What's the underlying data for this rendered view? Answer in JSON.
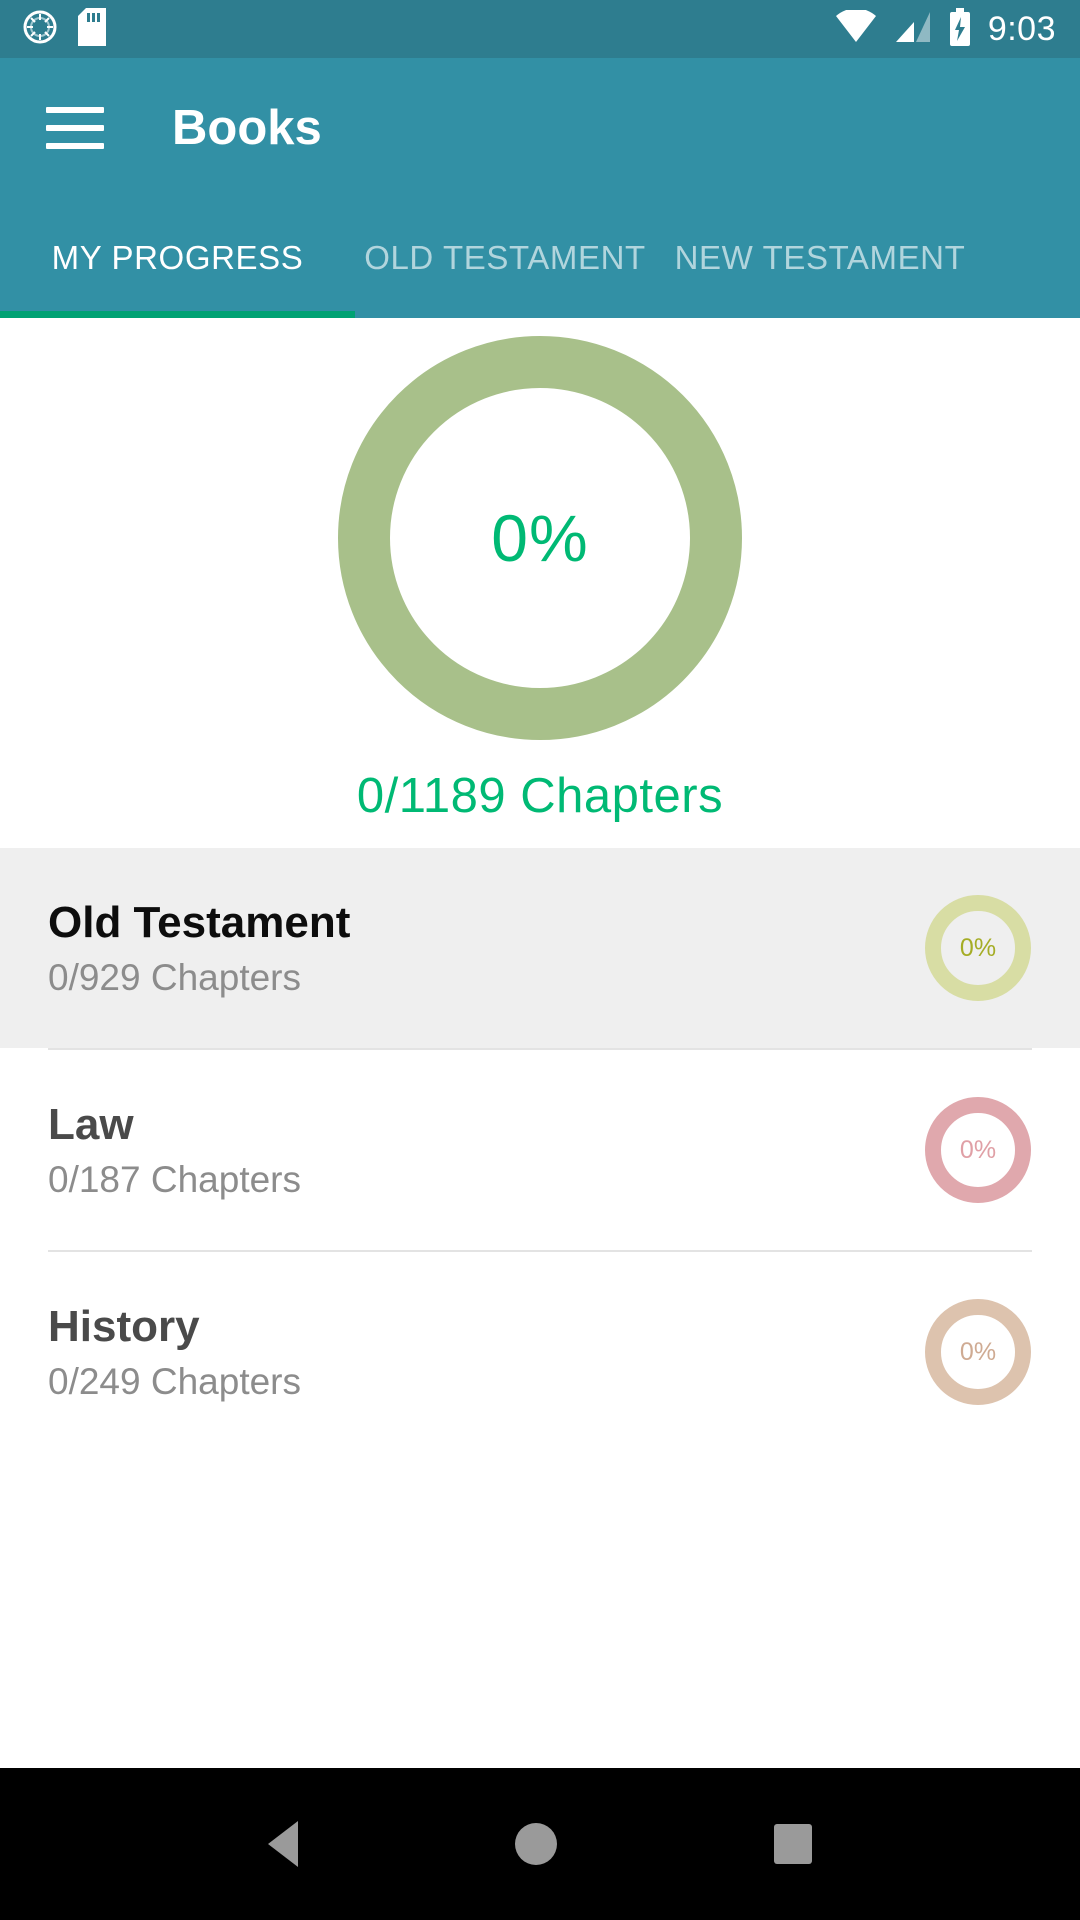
{
  "status_bar": {
    "time": "9:03",
    "left_icons": [
      "sync-icon",
      "sd-card-icon"
    ],
    "right_icons": [
      "wifi-icon",
      "cellular-signal-icon",
      "battery-charging-icon"
    ],
    "background_color": "#2e7d8f"
  },
  "app_bar": {
    "title": "Books",
    "menu_icon": "hamburger-menu-icon",
    "background_color": "#3290a5",
    "indicator_color": "#00a273"
  },
  "tabs": [
    {
      "label": "MY PROGRESS",
      "active": true
    },
    {
      "label": "OLD TESTAMENT",
      "active": false
    },
    {
      "label": "NEW TESTAMENT",
      "active": false
    }
  ],
  "hero": {
    "percent_label": "0%",
    "percent_value": 0,
    "chapters_label": "0/1189 Chapters",
    "chapters_read": 0,
    "chapters_total": 1189,
    "ring_color": "#a8c08a",
    "text_color": "#00b974"
  },
  "list": [
    {
      "title": "Old Testament",
      "subtitle": "0/929 Chapters",
      "chapters_read": 0,
      "chapters_total": 929,
      "percent_label": "0%",
      "percent_value": 0,
      "ring_color": "#d8dda4",
      "percent_text_color": "#a5ad26",
      "highlighted": true
    },
    {
      "title": "Law",
      "subtitle": "0/187 Chapters",
      "chapters_read": 0,
      "chapters_total": 187,
      "percent_label": "0%",
      "percent_value": 0,
      "ring_color": "#e0a8ad",
      "percent_text_color": "#e0a0a6",
      "highlighted": false
    },
    {
      "title": "History",
      "subtitle": "0/249 Chapters",
      "chapters_read": 0,
      "chapters_total": 249,
      "percent_label": "0%",
      "percent_value": 0,
      "ring_color": "#ddc3ae",
      "percent_text_color": "#cfab93",
      "highlighted": false
    }
  ],
  "nav_bar": {
    "back_icon": "back-triangle-icon",
    "home_icon": "home-circle-icon",
    "recents_icon": "recents-square-icon",
    "background_color": "#000000"
  }
}
